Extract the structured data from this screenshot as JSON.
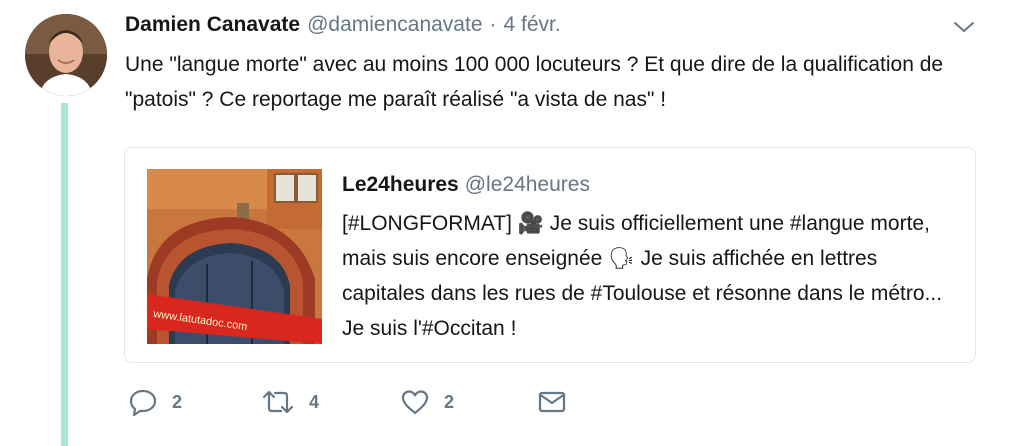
{
  "tweet": {
    "author_name": "Damien Canavate",
    "author_handle": "@damiencanavate",
    "separator": "·",
    "date": "4 févr.",
    "text": "Une \"langue morte\" avec au moins 100 000 locuteurs ? Et que dire de la qualification de \"patois\" ? Ce reportage me paraît réalisé \"a vista de nas\" !"
  },
  "quoted_tweet": {
    "author_name": "Le24heures",
    "author_handle": "@le24heures",
    "text": "[#LONGFORMAT] 🎥 Je suis officiellement une #langue morte, mais suis encore enseignée 🗣 Je suis affichée en lettres capitales dans les rues de #Toulouse et résonne dans le métro... Je suis l'#Occitan !",
    "image_sign_text": "www.latutadoc.com"
  },
  "actions": {
    "reply_count": "2",
    "retweet_count": "4",
    "like_count": "2"
  },
  "colors": {
    "thread_line": "#a9e8d4",
    "secondary_text": "#657786",
    "border": "#e1e8ed"
  }
}
